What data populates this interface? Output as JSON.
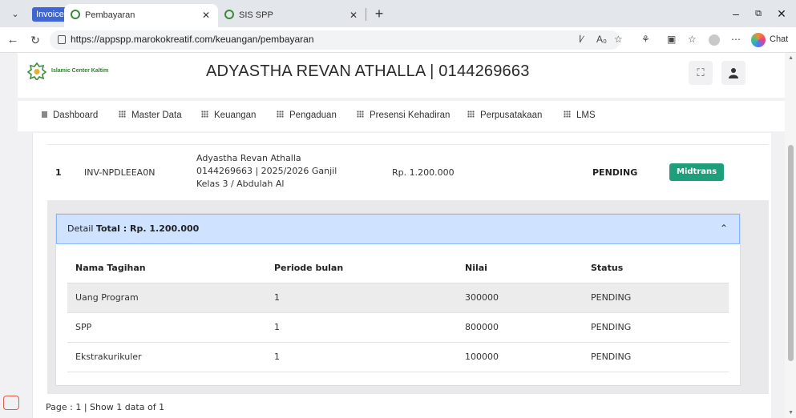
{
  "browser": {
    "group_badge": "Invoice",
    "tabs": [
      {
        "title": "Pembayaran",
        "active": true
      },
      {
        "title": "SIS SPP",
        "active": false
      }
    ],
    "url": "https://appspp.marokokreatif.com/keuangan/pembayaran",
    "chat_label": "Chat"
  },
  "app": {
    "logo_text": "Islamic Center Kaltim",
    "header_title": "ADYASTHA REVAN ATHALLA | 0144269663",
    "nav": [
      "Dashboard",
      "Master Data",
      "Keuangan",
      "Pengaduan",
      "Presensi Kehadiran",
      "Perpusatakaan",
      "LMS"
    ]
  },
  "invoice": {
    "no": "1",
    "code": "INV-NPDLEEA0N",
    "info_line1": "Adyastha Revan Athalla",
    "info_line2": "0144269663 | 2025/2026 Ganjil",
    "info_line3": "Kelas 3 / Abdulah Al",
    "amount": "Rp. 1.200.000",
    "status": "PENDING",
    "pay_button": "Midtrans"
  },
  "detail": {
    "label": "Detail",
    "total": "Total : Rp. 1.200.000",
    "columns": [
      "Nama Tagihan",
      "Periode bulan",
      "Nilai",
      "Status"
    ],
    "rows": [
      [
        "Uang Program",
        "1",
        "300000",
        "PENDING"
      ],
      [
        "SPP",
        "1",
        "800000",
        "PENDING"
      ],
      [
        "Ekstrakurikuler",
        "1",
        "100000",
        "PENDING"
      ]
    ]
  },
  "pagination": "Page : 1 | Show 1 data of 1",
  "colors": {
    "accent": "#1f9e7b",
    "detail_header": "#cfe2ff",
    "tab_group": "#4066d4"
  }
}
